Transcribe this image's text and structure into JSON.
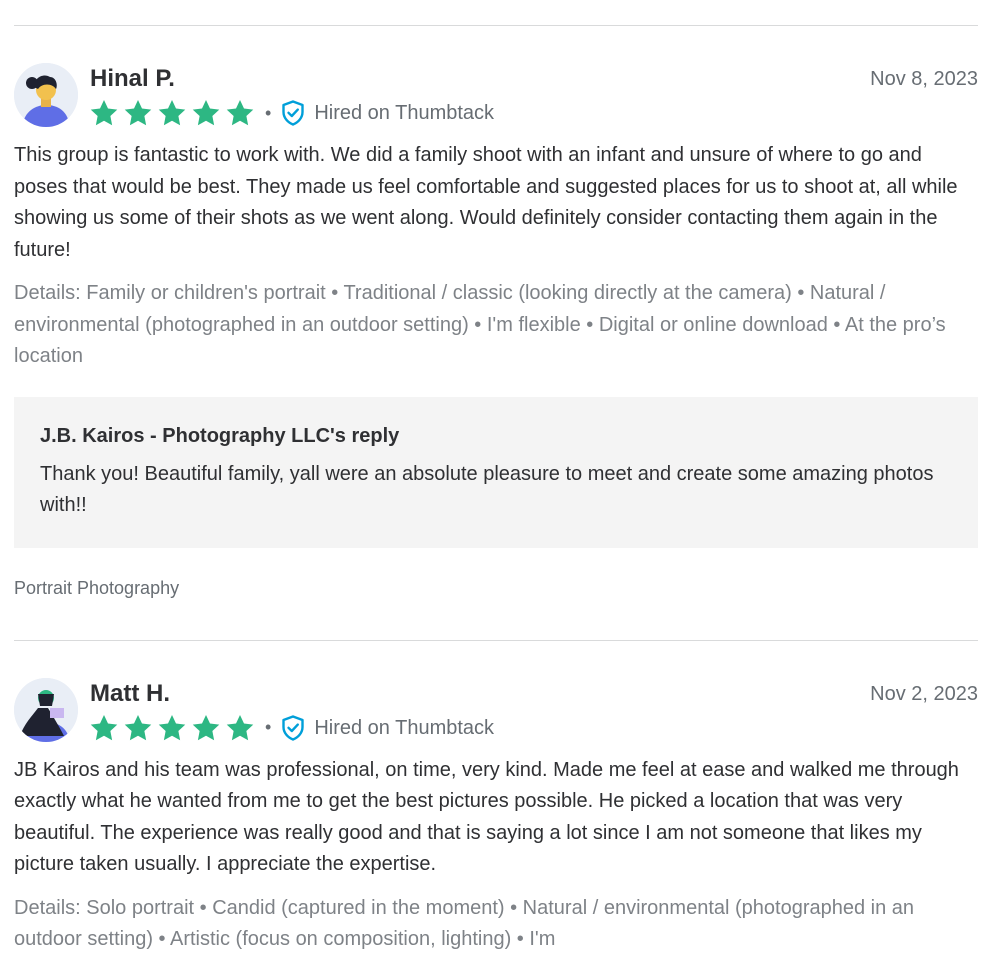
{
  "reviews": [
    {
      "name": "Hinal P.",
      "date": "Nov 8, 2023",
      "rating": 5,
      "hired_label": "Hired on Thumbtack",
      "text": "This group is fantastic to work with. We did a family shoot with an infant and unsure of where to go and poses that would be best. They made us feel comfortable and suggested places for us to shoot at, all while showing us some of their shots as we went along. Would definitely consider contacting them again in the future!",
      "details": "Details: Family or children's portrait • Traditional / classic (looking directly at the camera) • Natural / environmental (photographed in an outdoor setting) • I'm flexible • Digital or online download • At the pro’s location",
      "reply": {
        "title": "J.B. Kairos - Photography LLC's reply",
        "text": "Thank you! Beautiful family, yall were an absolute pleasure to meet and create some amazing photos with!!"
      },
      "category": "Portrait Photography"
    },
    {
      "name": "Matt H.",
      "date": "Nov 2, 2023",
      "rating": 5,
      "hired_label": "Hired on Thumbtack",
      "text": "JB Kairos and his team was professional, on time, very kind. Made me feel at ease and walked me through exactly what he wanted from me to get the best pictures possible. He picked a location that was very beautiful. The experience was really good and that is saying a lot since I am not someone that likes my picture taken usually. I appreciate the expertise.",
      "details": "Details: Solo portrait • Candid (captured in the moment) • Natural / environmental (photographed in an outdoor setting) • Artistic (focus on composition, lighting) • I'm"
    }
  ],
  "colors": {
    "star": "#2db783",
    "shield": "#009fd9",
    "muted_text": "#676d73",
    "body_text": "#2f3033",
    "reply_bg": "#f4f4f4"
  },
  "icons": {
    "star": "star-icon",
    "verified": "shield-check-icon",
    "avatar": "avatar-icon"
  }
}
